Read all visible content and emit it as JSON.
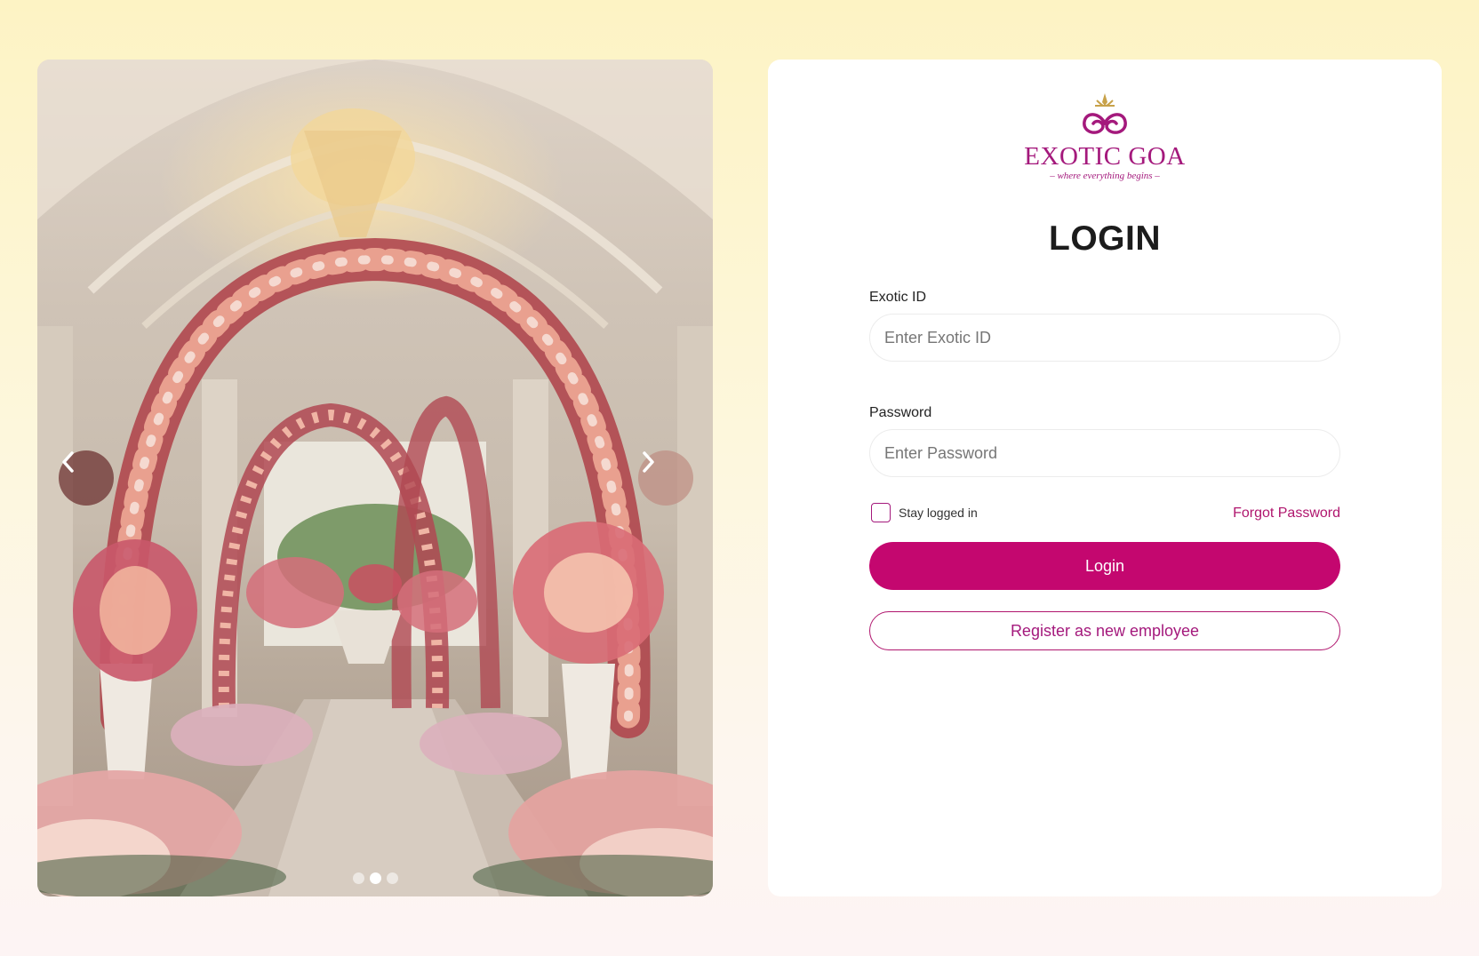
{
  "carousel": {
    "image_alt": "Floral wedding archway hall",
    "prev_icon": "chevron-left-icon",
    "next_icon": "chevron-right-icon",
    "slide_count": 3,
    "active_slide": 2
  },
  "brand": {
    "name": "EXOTIC GOA",
    "tagline": "– where everything begins –",
    "color": "#a4197c"
  },
  "login": {
    "title": "LOGIN",
    "exotic_id_label": "Exotic ID",
    "exotic_id_placeholder": "Enter Exotic ID",
    "exotic_id_value": "",
    "password_label": "Password",
    "password_placeholder": "Enter Password",
    "password_value": "",
    "stay_logged_in_label": "Stay logged in",
    "stay_logged_in_checked": false,
    "forgot_password_label": "Forgot Password",
    "login_button_label": "Login",
    "register_button_label": "Register as new employee",
    "accent_color": "#c4076f"
  }
}
